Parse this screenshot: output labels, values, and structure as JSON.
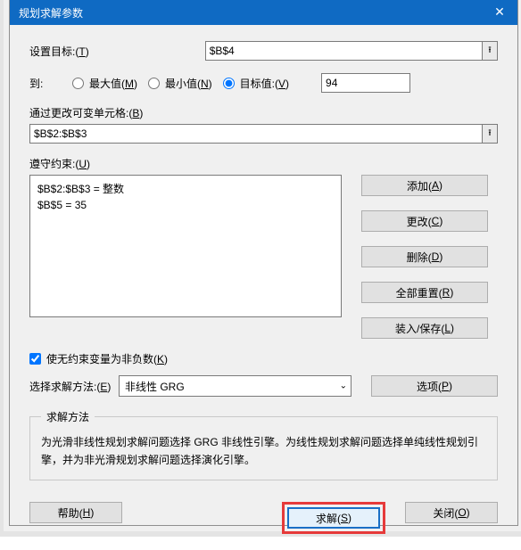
{
  "title": "规划求解参数",
  "close_glyph": "✕",
  "labels": {
    "set_target": "设置目标:(",
    "set_target_key": "T",
    "set_target_end": ")",
    "to": "到:",
    "max": "最大值(",
    "max_key": "M",
    "max_end": ")",
    "min": "最小值(",
    "min_key": "N",
    "min_end": ")",
    "value_of": "目标值:(",
    "value_of_key": "V",
    "value_of_end": ")",
    "by_changing": "通过更改可变单元格:(",
    "by_changing_key": "B",
    "by_changing_end": ")",
    "subject_to": "遵守约束:(",
    "subject_to_key": "U",
    "subject_to_end": ")",
    "nonneg": "使无约束变量为非负数(",
    "nonneg_key": "K",
    "nonneg_end": ")",
    "method_select": "选择求解方法:(",
    "method_select_key": "E",
    "method_select_end": ")",
    "method_legend": "求解方法"
  },
  "values": {
    "target": "$B$4",
    "target_value": "94",
    "changing": "$B$2:$B$3",
    "constraints": [
      "$B$2:$B$3 = 整数",
      "$B$5 = 35"
    ],
    "nonneg_checked": true,
    "method": "非线性 GRG"
  },
  "buttons": {
    "add": "添加(",
    "add_key": "A",
    "change": "更改(",
    "change_key": "C",
    "delete": "删除(",
    "delete_key": "D",
    "reset": "全部重置(",
    "reset_key": "R",
    "loadsave": "装入/保存(",
    "loadsave_key": "L",
    "options": "选项(",
    "options_key": "P",
    "help": "帮助(",
    "help_key": "H",
    "solve": "求解(",
    "solve_key": "S",
    "close": "关闭(",
    "close_key": "O",
    "end": ")"
  },
  "method_desc": "为光滑非线性规划求解问题选择 GRG 非线性引擎。为线性规划求解问题选择单纯线性规划引擎，并为非光滑规划求解问题选择演化引擎。",
  "spin_glyph": "⭱",
  "chev_glyph": "⌄"
}
